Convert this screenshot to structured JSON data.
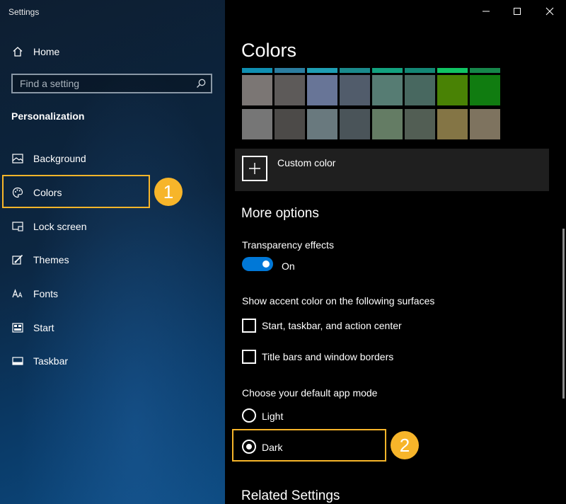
{
  "window": {
    "title": "Settings",
    "controls": [
      "minimize",
      "maximize",
      "close"
    ]
  },
  "sidebar": {
    "home": {
      "label": "Home",
      "icon": "home-icon"
    },
    "search": {
      "placeholder": "Find a setting",
      "icon": "search-icon"
    },
    "section_title": "Personalization",
    "items": [
      {
        "label": "Background",
        "icon": "picture-icon"
      },
      {
        "label": "Colors",
        "icon": "palette-icon",
        "selected": true
      },
      {
        "label": "Lock screen",
        "icon": "lock-screen-icon"
      },
      {
        "label": "Themes",
        "icon": "brush-icon"
      },
      {
        "label": "Fonts",
        "icon": "fonts-icon"
      },
      {
        "label": "Start",
        "icon": "start-icon"
      },
      {
        "label": "Taskbar",
        "icon": "taskbar-icon"
      }
    ]
  },
  "main": {
    "title": "Colors",
    "accent_strip_colors": [
      "#0f8fb1",
      "#2b7d9f",
      "#1e9eb3",
      "#1a8a8c",
      "#12a27f",
      "#138775",
      "#10c464",
      "#16874b"
    ],
    "swatches_row1": [
      "#7b7674",
      "#5d5a59",
      "#687597",
      "#515c6b",
      "#567c73",
      "#486860",
      "#498205",
      "#107c10"
    ],
    "swatches_row2": [
      "#767676",
      "#4c4a48",
      "#69797e",
      "#4a5459",
      "#647c64",
      "#525e54",
      "#847545",
      "#7e735f"
    ],
    "custom_color": {
      "label": "Custom color",
      "icon": "plus-icon"
    },
    "more_options": {
      "title": "More options",
      "transparency": {
        "label": "Transparency effects",
        "state": "On",
        "on": true
      },
      "accent_surfaces": {
        "label": "Show accent color on the following surfaces",
        "options": [
          {
            "label": "Start, taskbar, and action center",
            "checked": false
          },
          {
            "label": "Title bars and window borders",
            "checked": false
          }
        ]
      },
      "app_mode": {
        "label": "Choose your default app mode",
        "options": [
          {
            "label": "Light",
            "selected": false
          },
          {
            "label": "Dark",
            "selected": true
          }
        ]
      }
    },
    "related_title": "Related Settings"
  },
  "annotations": [
    {
      "number": "1",
      "color": "#f7b52a",
      "target": "sidebar-item-colors"
    },
    {
      "number": "2",
      "color": "#f7b52a",
      "target": "dark-mode-radio"
    }
  ]
}
